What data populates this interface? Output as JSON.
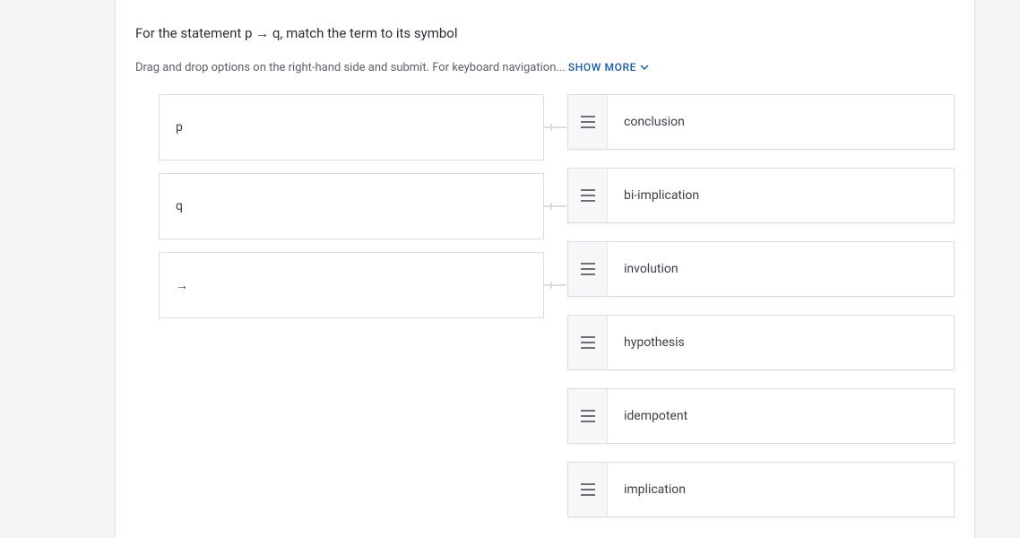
{
  "question": {
    "title": "For the statement p → q, match the term to its symbol",
    "instructions": "Drag and drop options on the right-hand side and submit. For keyboard navigation... ",
    "show_more_label": "SHOW MORE"
  },
  "left_items": [
    {
      "label": "p"
    },
    {
      "label": "q"
    },
    {
      "label": "→"
    }
  ],
  "right_items": [
    {
      "label": "conclusion"
    },
    {
      "label": "bi-implication"
    },
    {
      "label": "involution"
    },
    {
      "label": "hypothesis"
    },
    {
      "label": "idempotent"
    },
    {
      "label": "implication"
    }
  ]
}
